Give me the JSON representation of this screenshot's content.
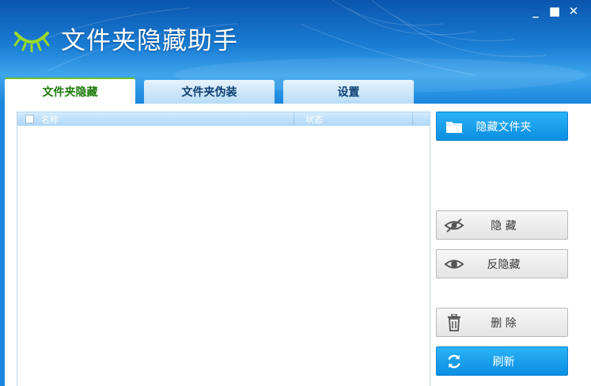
{
  "app": {
    "title": "文件夹隐藏助手",
    "controls": {
      "minimize": "_",
      "maximize": "■",
      "close": "✕"
    }
  },
  "tabs": [
    {
      "label": "文件夹隐藏",
      "active": true
    },
    {
      "label": "文件夹伪装",
      "active": false
    },
    {
      "label": "设置",
      "active": false
    }
  ],
  "list": {
    "columns": {
      "name": "名称",
      "status": "状态"
    },
    "rows": []
  },
  "buttons": {
    "hide_folder": {
      "label": "隐藏文件夹",
      "icon": "folder-icon"
    },
    "hide": {
      "label": "隐 藏",
      "icon": "eye-slash-icon"
    },
    "unhide": {
      "label": "反隐藏",
      "icon": "eye-icon"
    },
    "delete": {
      "label": "删 除",
      "icon": "trash-icon"
    },
    "refresh": {
      "label": "刷新",
      "icon": "refresh-icon"
    }
  },
  "colors": {
    "primary_button": "#16a0ec",
    "active_tab_text": "#1d7a0a",
    "header_blue": "#1b7fd6"
  }
}
